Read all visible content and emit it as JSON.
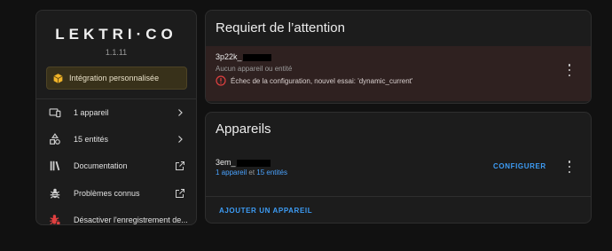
{
  "integration": {
    "logo_text": "LEKTRI·CO",
    "version": "1.1.11",
    "custom_badge": "Intégration personnalisée",
    "menu": [
      {
        "label": "1 appareil",
        "icon": "devices-icon",
        "end_icon": "chevron-right-icon"
      },
      {
        "label": "15 entités",
        "icon": "shapes-icon",
        "end_icon": "chevron-right-icon"
      },
      {
        "label": "Documentation",
        "icon": "book-icon",
        "end_icon": "open-in-new-icon"
      },
      {
        "label": "Problèmes connus",
        "icon": "bug-icon",
        "end_icon": "open-in-new-icon"
      },
      {
        "label": "Désactiver l'enregistrement de..."
      }
    ]
  },
  "attention": {
    "title": "Requiert de l’attention",
    "entry": {
      "name": "3p22k_",
      "subtitle": "Aucun appareil ou entité",
      "error": "Échec de la configuration, nouvel essai: 'dynamic_current'"
    }
  },
  "devices": {
    "title": "Appareils",
    "entry": {
      "name": "3em_",
      "devices_link": "1 appareil",
      "connector": "et",
      "entities_link": "15 entités",
      "configure_label": "CONFIGURER"
    },
    "add_label": "AJOUTER UN APPAREIL"
  },
  "colors": {
    "background": "#111111",
    "card": "#1c1c1c",
    "accent": "#3d9cf5",
    "error": "#e04040",
    "warning_badge": "#38311a"
  }
}
